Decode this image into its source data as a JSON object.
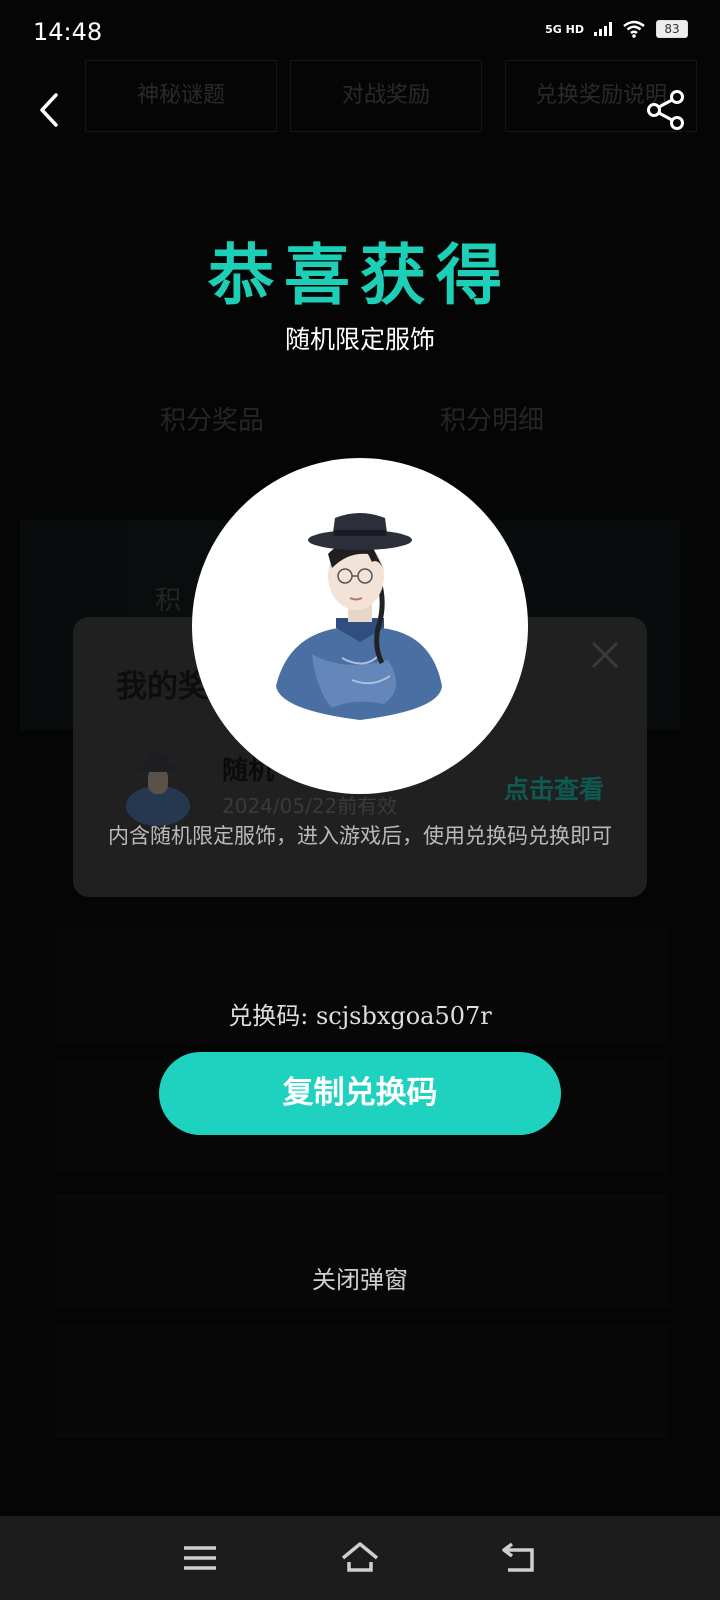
{
  "status_bar": {
    "time": "14:48",
    "network": "5G HD",
    "battery": "83"
  },
  "popup": {
    "title": "恭喜获得",
    "subtitle": "随机限定服饰",
    "code_label": "兑换码:",
    "code_value": "scjsbxgoa507r",
    "copy_button": "复制兑换码",
    "close_text": "关闭弹窗"
  },
  "panel": {
    "heading": "我的奖",
    "item_title": "随机",
    "item_date": "2024/05/22前有效",
    "view_label": "点击查看",
    "description": "内含随机限定服饰，进入游戏后，使用兑换码兑换即可"
  },
  "background": {
    "tab_1": "神秘谜题",
    "tab_2": "对战奖励",
    "tab_3": "兑换奖励说明",
    "text_1": "积分奖品",
    "text_2": "积分明细",
    "text_3": "积"
  },
  "icons": {
    "back": "back-arrow-icon",
    "share": "share-icon",
    "close": "close-icon",
    "menu": "menu-icon",
    "home": "home-icon",
    "return": "return-icon"
  },
  "colors": {
    "accent": "#1fd2bf",
    "title": "#1ecfb7"
  }
}
